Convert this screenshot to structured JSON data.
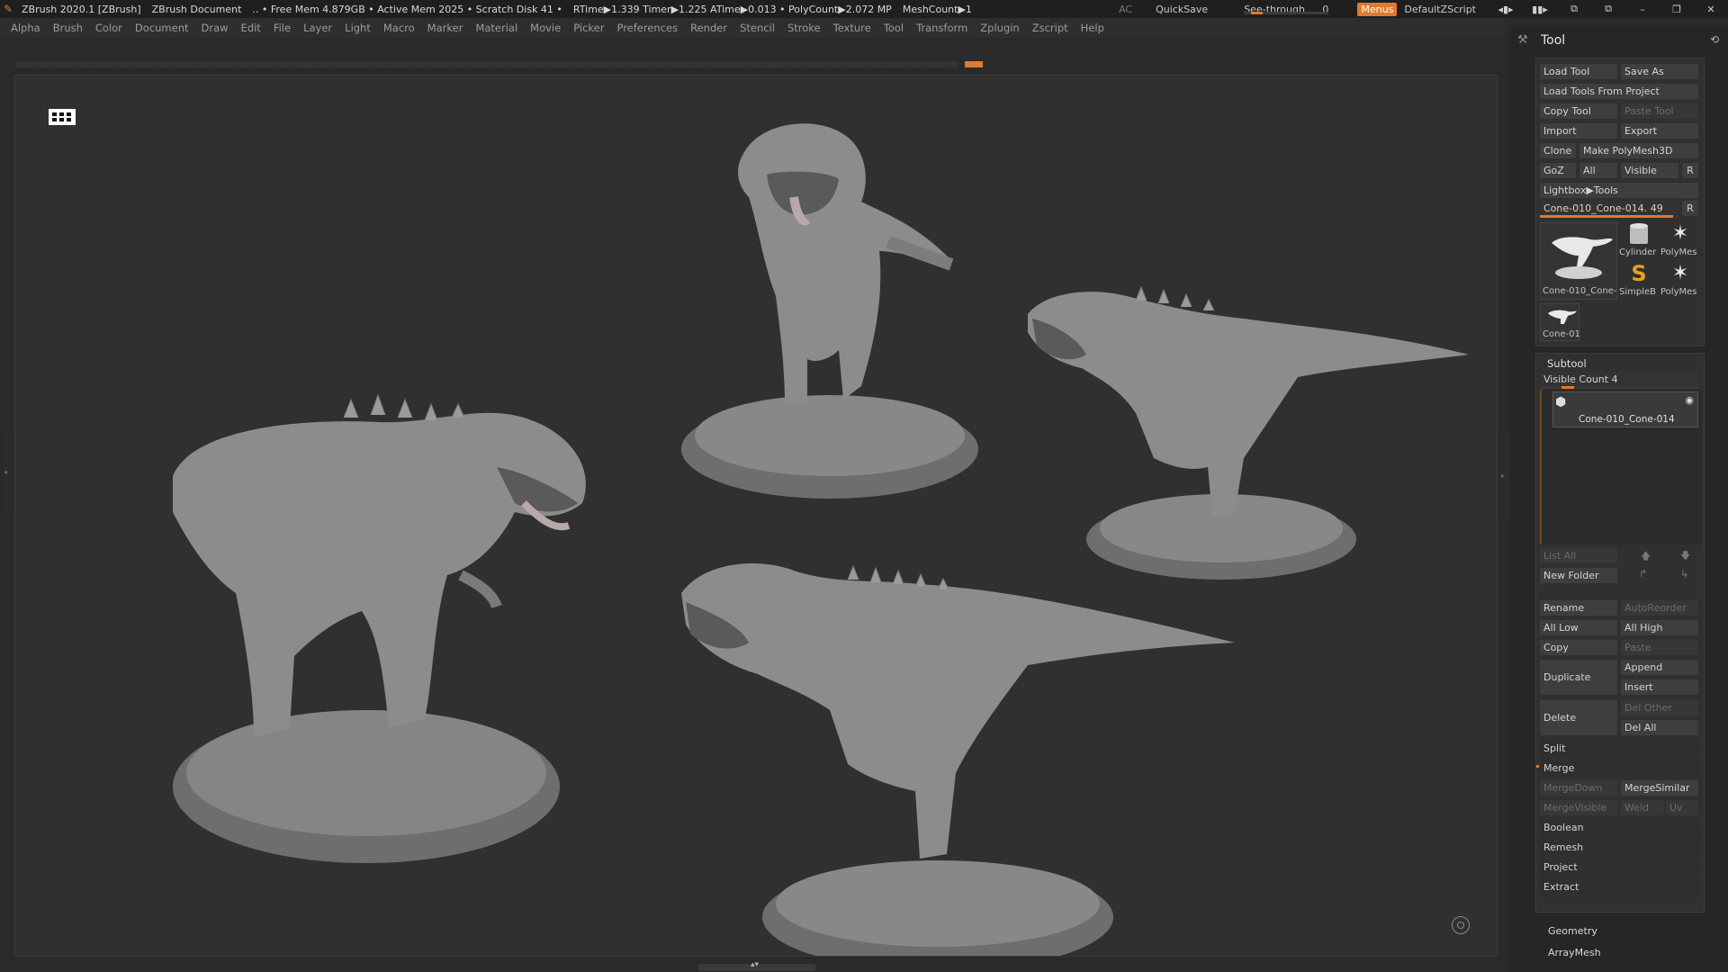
{
  "titlebar": {
    "app": "ZBrush 2020.1 [ZBrush]",
    "document": "ZBrush Document",
    "stats": ".. • Free Mem 4.879GB • Active Mem 2025 • Scratch Disk 41 •",
    "timing": "RTime▶1.339 Timer▶1.225 ATime▶0.013 • PolyCount▶2.072 MP",
    "meshcount": "MeshCount▶1",
    "ac": "AC",
    "quicksave": "QuickSave",
    "see_through_label": "See-through",
    "see_through_value": "0",
    "see_through_level": 0.0,
    "menus": "Menus",
    "script": "DefaultZScript"
  },
  "menubar": [
    "Alpha",
    "Brush",
    "Color",
    "Document",
    "Draw",
    "Edit",
    "File",
    "Layer",
    "Light",
    "Macro",
    "Marker",
    "Material",
    "Movie",
    "Picker",
    "Preferences",
    "Render",
    "Stencil",
    "Stroke",
    "Texture",
    "Tool",
    "Transform",
    "Zplugin",
    "Zscript",
    "Help"
  ],
  "tool_panel": {
    "title": "Tool",
    "load_tool": "Load Tool",
    "save_as": "Save As",
    "load_from_project": "Load Tools From Project",
    "copy_tool": "Copy Tool",
    "paste_tool": "Paste Tool",
    "import": "Import",
    "export": "Export",
    "clone": "Clone",
    "make_polymesh": "Make PolyMesh3D",
    "goz": "GoZ",
    "all": "All",
    "visible": "Visible",
    "r": "R",
    "lightbox": "Lightbox▶Tools",
    "current_tool": "Cone-010_Cone-014. 49",
    "current_tool_r": "R",
    "thumbs": {
      "main": "Cone-010_Cone-",
      "cylinder": "Cylinder",
      "polymesh1": "PolyMes",
      "simpleb": "SimpleB",
      "polymesh2": "PolyMes",
      "cone": "Cone-01"
    }
  },
  "subtool": {
    "title": "Subtool",
    "visible_count": "Visible Count 4",
    "item_name": "Cone-010_Cone-014",
    "list_all": "List All",
    "new_folder": "New Folder",
    "rename": "Rename",
    "autoreorder": "AutoReorder",
    "all_low": "All Low",
    "all_high": "All High",
    "copy": "Copy",
    "paste": "Paste",
    "duplicate": "Duplicate",
    "append": "Append",
    "insert": "Insert",
    "delete": "Delete",
    "del_other": "Del Other",
    "del_all": "Del All",
    "split": "Split",
    "merge": "Merge",
    "mergedown": "MergeDown",
    "mergesimilar": "MergeSimilar",
    "mergevisible": "MergeVisible",
    "weld": "Weld",
    "uv": "Uv",
    "boolean": "Boolean",
    "remesh": "Remesh",
    "project": "Project",
    "extract": "Extract"
  },
  "geometry": "Geometry",
  "arraymesh": "ArrayMesh",
  "colors": {
    "accent": "#e07a2c",
    "background": "#2a2a2a",
    "model": "#8a8a8a"
  }
}
